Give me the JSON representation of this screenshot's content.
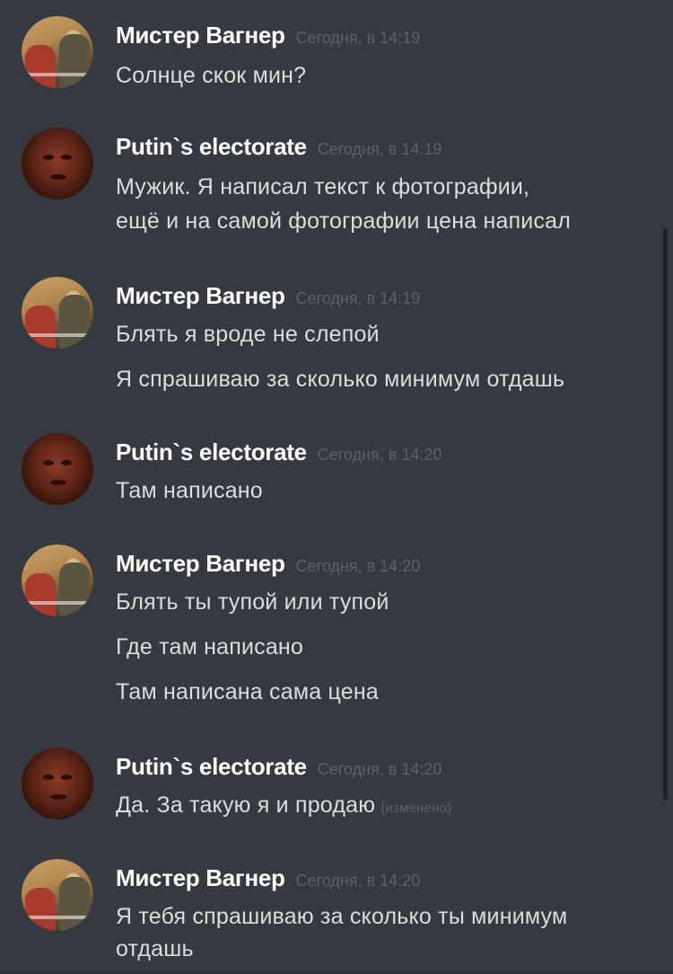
{
  "users": {
    "wagner": "Мистер Вагнер",
    "putin": "Putin`s electorate"
  },
  "messages": [
    {
      "author": "Мистер Вагнер",
      "time": "Сегодня, в 14:19",
      "lines": [
        "Солнце скок мин?"
      ]
    },
    {
      "author": "Putin`s electorate",
      "time": "Сегодня, в 14:19",
      "lines": [
        "Мужик. Я написал текст к фотографии,",
        "ещё и на самой фотографии цена написал"
      ]
    },
    {
      "author": "Мистер Вагнер",
      "time": "Сегодня, в 14:19",
      "lines": [
        "Блять я вроде не слепой",
        "Я спрашиваю за сколько минимум отдашь"
      ]
    },
    {
      "author": "Putin`s electorate",
      "time": "Сегодня, в 14:20",
      "lines": [
        "Там написано"
      ]
    },
    {
      "author": "Мистер Вагнер",
      "time": "Сегодня, в 14:20",
      "lines": [
        "Блять ты тупой или тупой",
        "Где там написано",
        "Там написана сама цена"
      ]
    },
    {
      "author": "Putin`s electorate",
      "time": "Сегодня, в 14:20",
      "lines": [
        "Да. За такую я и продаю"
      ],
      "edited": "(изменено)"
    },
    {
      "author": "Мистер Вагнер",
      "time": "Сегодня, в 14:20",
      "lines": [
        "Я тебя спрашиваю за сколько ты минимум",
        "отдашь"
      ]
    }
  ],
  "colors": {
    "background": "#36393f",
    "username": "#ffffff",
    "text": "#dcddde",
    "timestamp": "#5c6068"
  }
}
